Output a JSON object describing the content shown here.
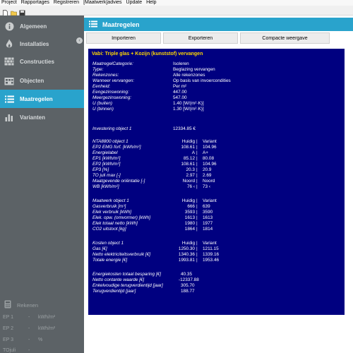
{
  "menubar": {
    "items": [
      "Project",
      "Rapportages",
      "Registreren",
      "[Maatwerk]advies",
      "Update",
      "Help"
    ]
  },
  "toolbar": {
    "icons": [
      "new-file-icon",
      "open-folder-icon",
      "save-icon"
    ]
  },
  "sidebar": {
    "items": [
      {
        "label": "Algemeen",
        "icon": "info-icon",
        "active": false
      },
      {
        "label": "Installaties",
        "icon": "flame-icon",
        "active": false
      },
      {
        "label": "Constructies",
        "icon": "wall-icon",
        "active": false
      },
      {
        "label": "Objecten",
        "icon": "building-icon",
        "active": false
      },
      {
        "label": "Maatregelen",
        "icon": "list-icon",
        "active": true
      },
      {
        "label": "Varianten",
        "icon": "bar-chart-icon",
        "active": false
      }
    ],
    "collapse_glyph": "‹",
    "rekenen": {
      "title": "Rekenen",
      "rows": [
        {
          "label": "EP 1",
          "sep": "-",
          "unit": "kWh/m²"
        },
        {
          "label": "EP 2",
          "sep": "-",
          "unit": "kWh/m²"
        },
        {
          "label": "EP 3",
          "sep": "-",
          "unit": "%"
        },
        {
          "label": "TOjuli",
          "sep": "-",
          "unit": ""
        }
      ]
    }
  },
  "header": {
    "title": "Maatregelen"
  },
  "buttons": {
    "import": "Importeren",
    "export": "Exporteren",
    "compact": "Compacte weergave"
  },
  "panel": {
    "title": "Vabi: Triple glas + Kozijn (kunststof) vervangen",
    "info": [
      {
        "k": "MaatregelCategorie:",
        "v": "Isoleren"
      },
      {
        "k": "Type:",
        "v": "Beglazing vervangen"
      },
      {
        "k": "Rekenzones:",
        "v": "Alle rekenzones"
      },
      {
        "k": "Wanneer vervangen:",
        "v": "Op basis van invoercondities"
      },
      {
        "k": "Eenheid:",
        "v": "Per m²"
      },
      {
        "k": "Eengezinswoning:",
        "v": "447.00"
      },
      {
        "k": "Meergezinswoning:",
        "v": "547.00"
      },
      {
        "k": "U (buiten)",
        "v": "1.40 [W/(m²·K)]"
      },
      {
        "k": "U (binnen)",
        "v": "1.30 [W/(m²·K)]"
      }
    ],
    "investering": {
      "k": "Investering object 1",
      "v": "12334.85 €"
    },
    "nta": {
      "header": {
        "k": "NTA8800 object 1",
        "a": "Huidig",
        "b": "Variant"
      },
      "rows": [
        {
          "k": "EP2 EMG forf. [kWh/m²]",
          "a": "108.61",
          "b": "104.96"
        },
        {
          "k": "Energielabel",
          "a": "A",
          "b": "A+"
        },
        {
          "k": "EP1 [kWh/m²]",
          "a": "85.12",
          "b": "80.08"
        },
        {
          "k": "EP2 [kWh/m²]",
          "a": "108.61",
          "b": "104.96"
        },
        {
          "k": "EP3 [%]",
          "a": "20.3",
          "b": "20.9"
        },
        {
          "k": "TO juli max [-]",
          "a": "2.97",
          "b": "2.69"
        },
        {
          "k": "Maatgevende oriëntatie [-]",
          "a": "Noord",
          "b": "Noord"
        },
        {
          "k": "WB [kWh/m²]",
          "a": "76 ‹",
          "b": "73 ‹"
        }
      ]
    },
    "maatwerk": {
      "header": {
        "k": "Maatwerk object 1",
        "a": "Huidig",
        "b": "Variant"
      },
      "rows": [
        {
          "k": "Gasverbruik [m³]",
          "a": "666",
          "b": "639"
        },
        {
          "k": "Elek verbruik [kWh]",
          "a": "3593",
          "b": "3590"
        },
        {
          "k": "Elek. opw. (omvormer) [kWh]",
          "a": "1613",
          "b": "1613"
        },
        {
          "k": "Elek totaal netto [kWh]",
          "a": "1980",
          "b": "1977"
        },
        {
          "k": "CO2 uitstoot [kg]",
          "a": "1864",
          "b": "1814"
        }
      ]
    },
    "kosten": {
      "header": {
        "k": "Kosten object 1",
        "a": "Huidig",
        "b": "Variant"
      },
      "rows": [
        {
          "k": "Gas [€]",
          "a": "1250.30",
          "b": "1211.15"
        },
        {
          "k": "Netto elektriciteitsverbruik [€]",
          "a": "1340.36",
          "b": "1339.16"
        },
        {
          "k": "Totale energie [€]",
          "a": "1993.81",
          "b": "1953.46"
        }
      ]
    },
    "summary": [
      {
        "k": "Energiekosten totaal besparing [€]",
        "v": "40.35"
      },
      {
        "k": "Netto contante waarde [€]",
        "v": "-12337.88"
      },
      {
        "k": "Enkelvoudige terugverdientijd [jaar]",
        "v": "305.70"
      },
      {
        "k": "Terugverdientijd [jaar]",
        "v": "188.77"
      }
    ],
    "colsep": "|"
  },
  "colors": {
    "accent": "#29a3cc",
    "sidebar": "#5c6266",
    "panel": "#000080",
    "panel_title": "#ffd700"
  }
}
